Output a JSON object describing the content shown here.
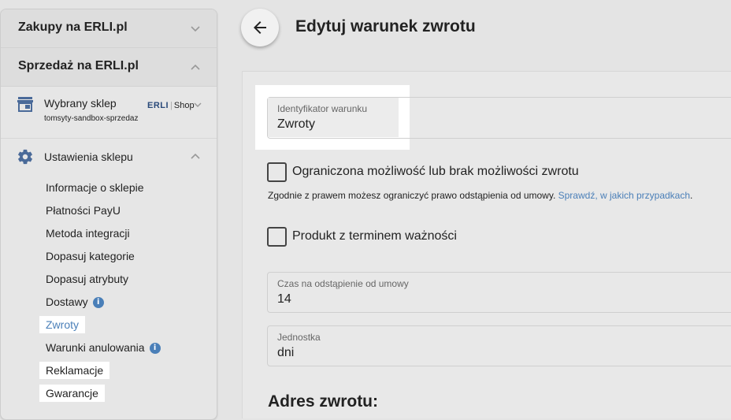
{
  "sidebar": {
    "sections": [
      {
        "label": "Zakupy na ERLI.pl"
      },
      {
        "label": "Sprzedaż na ERLI.pl"
      }
    ],
    "shop": {
      "title": "Wybrany sklep",
      "subtitle": "tomsyty-sandbox-sprzedaz",
      "logo_main": "ERLI",
      "logo_sub": "Shop"
    },
    "settings": {
      "title": "Ustawienia sklepu",
      "items": [
        {
          "label": "Informacje o sklepie"
        },
        {
          "label": "Płatności PayU"
        },
        {
          "label": "Metoda integracji"
        },
        {
          "label": "Dopasuj kategorie"
        },
        {
          "label": "Dopasuj atrybuty"
        },
        {
          "label": "Dostawy"
        },
        {
          "label": "Zwroty"
        },
        {
          "label": "Warunki anulowania"
        },
        {
          "label": "Reklamacje"
        },
        {
          "label": "Gwarancje"
        }
      ]
    }
  },
  "header": {
    "title": "Edytuj warunek zwrotu"
  },
  "form": {
    "identifier": {
      "label": "Identyfikator warunku",
      "value": "Zwroty"
    },
    "limited_return": {
      "label": "Ograniczona możliwość lub brak możliwości zwrotu",
      "checked": false
    },
    "hint_text": "Zgodnie z prawem możesz ograniczyć prawo odstąpienia od umowy. ",
    "hint_link": "Sprawdź, w jakich przypadkach",
    "hint_end": ".",
    "expiry_product": {
      "label": "Produkt z terminem ważności",
      "checked": false
    },
    "withdrawal_time": {
      "label": "Czas na odstąpienie od umowy",
      "value": "14"
    },
    "unit": {
      "label": "Jednostka",
      "value": "dni"
    },
    "address_title": "Adres zwrotu:"
  },
  "colors": {
    "accent": "#4a7fb8",
    "background": "#e4e4e4",
    "highlight": "#ffffff"
  }
}
